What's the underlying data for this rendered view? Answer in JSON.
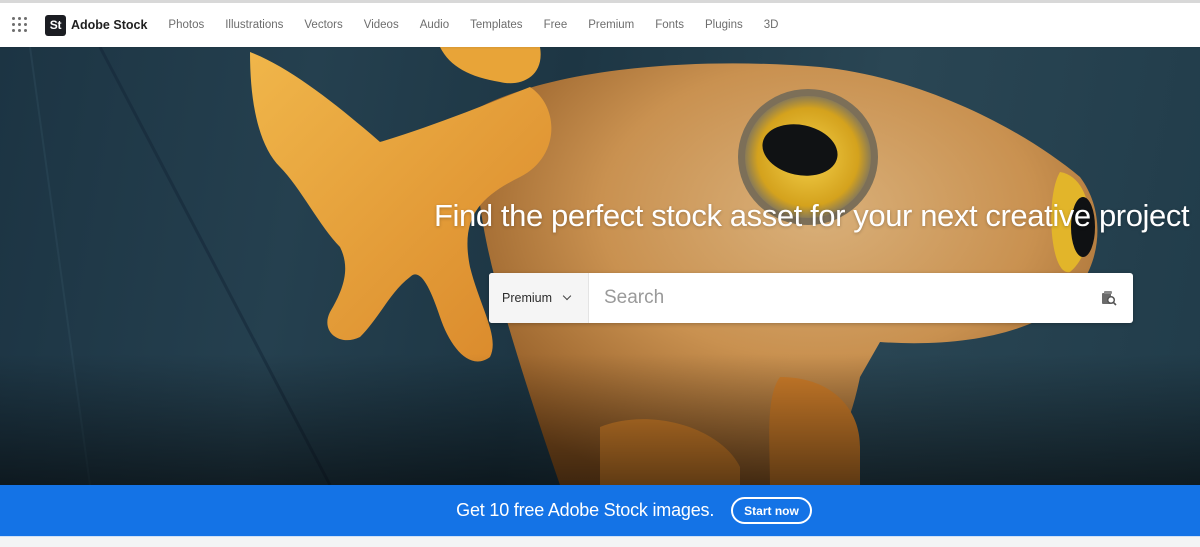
{
  "header": {
    "app_switcher_icon": "apps-grid-icon",
    "logo_badge": "St",
    "logo_text": "Adobe Stock",
    "nav": [
      {
        "label": "Photos"
      },
      {
        "label": "Illustrations"
      },
      {
        "label": "Vectors"
      },
      {
        "label": "Videos"
      },
      {
        "label": "Audio"
      },
      {
        "label": "Templates"
      },
      {
        "label": "Free"
      },
      {
        "label": "Premium"
      },
      {
        "label": "Fonts"
      },
      {
        "label": "Plugins"
      },
      {
        "label": "3D"
      }
    ]
  },
  "hero": {
    "headline": "Find the perfect stock asset for your next creative project",
    "image_subject": "orange tree frog on dark teal background",
    "search": {
      "filter_selected": "Premium",
      "placeholder": "Search",
      "value": "",
      "visual_search_icon": "visual-search-icon"
    }
  },
  "promo": {
    "text": "Get 10 free Adobe Stock images.",
    "button_label": "Start now",
    "color": "#1473e6"
  }
}
